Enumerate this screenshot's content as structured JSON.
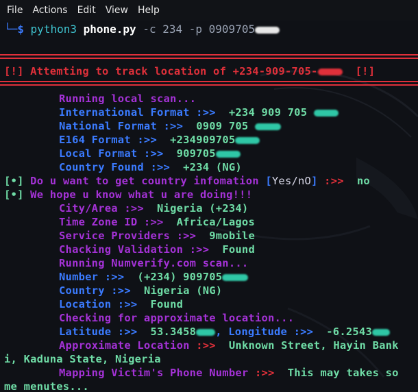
{
  "menu": {
    "file": "File",
    "actions": "Actions",
    "edit": "Edit",
    "view": "View",
    "help": "Help"
  },
  "prompt": {
    "corner": "└─",
    "dollar": "$",
    "cmd": "python3",
    "script": "phone.py",
    "args": "-c 234 -p 0909705"
  },
  "banner": {
    "tag": "[!]",
    "text": "Attemting to track location of +234-909-705-",
    "tag_end": "[!]"
  },
  "lines": {
    "running_local": "Running local scan...",
    "intl_label": "International Format :>>",
    "intl_value": "+234 909 705",
    "national_label": "National Format :>>",
    "national_value": "0909 705",
    "e164_label": "E164 Format :>>",
    "e164_value": "+234909705",
    "local_label": "Local Format :>>",
    "local_value": "909705",
    "country_found_label": "Country Found :>>",
    "country_found_value": "+234 (NG)",
    "q_bullet": "[•]",
    "q_text": "Do u want to get country infomation",
    "q_yesno_open": "[",
    "q_yesno": "Yes/nO",
    "q_yesno_close": "]",
    "q_arrow": ":>>",
    "q_answer": "no",
    "hope_bullet": "[•]",
    "hope_text": "We hope u know what u are doing!!!",
    "city_label": "City/Area :>>",
    "city_value": "Nigeria (+234)",
    "tz_label": "Time Zone ID :>>",
    "tz_value": "Africa/Lagos",
    "sp_label": "Service Providers :>>",
    "sp_value": "9mobile",
    "cv_label": "Chacking Validation :>>",
    "cv_value": "Found",
    "numverify": "Running Numverify.com scan...",
    "number_label": "Number :>>",
    "number_value": "(+234) 909705",
    "country_label": "Country :>>",
    "country_value": "Nigeria (NG)",
    "location_label": "Location :>>",
    "location_value": "Found",
    "approx_check": "Checking for approximate location...",
    "lat_label": "Latitude :>>",
    "lat_value": "53.3458",
    "lon_label": ", Longitude :>>",
    "lon_value": "-6.2543",
    "approx_label": "Approximate Location",
    "approx_arrow": ":>>",
    "approx_value": "Unknown Street, Hayin Bank",
    "approx_value_cont": "i, Kaduna State, Nigeria",
    "mapping_label": "Mapping Victim's Phone Number",
    "mapping_arrow": ":>>",
    "mapping_value": "This may takes so",
    "mapping_value_cont": "me menutes..."
  },
  "colors": {
    "background": "#0f1116",
    "purple": "#a432d6",
    "blue": "#3b7bff",
    "green": "#6fdca6",
    "red": "#e0303a"
  }
}
